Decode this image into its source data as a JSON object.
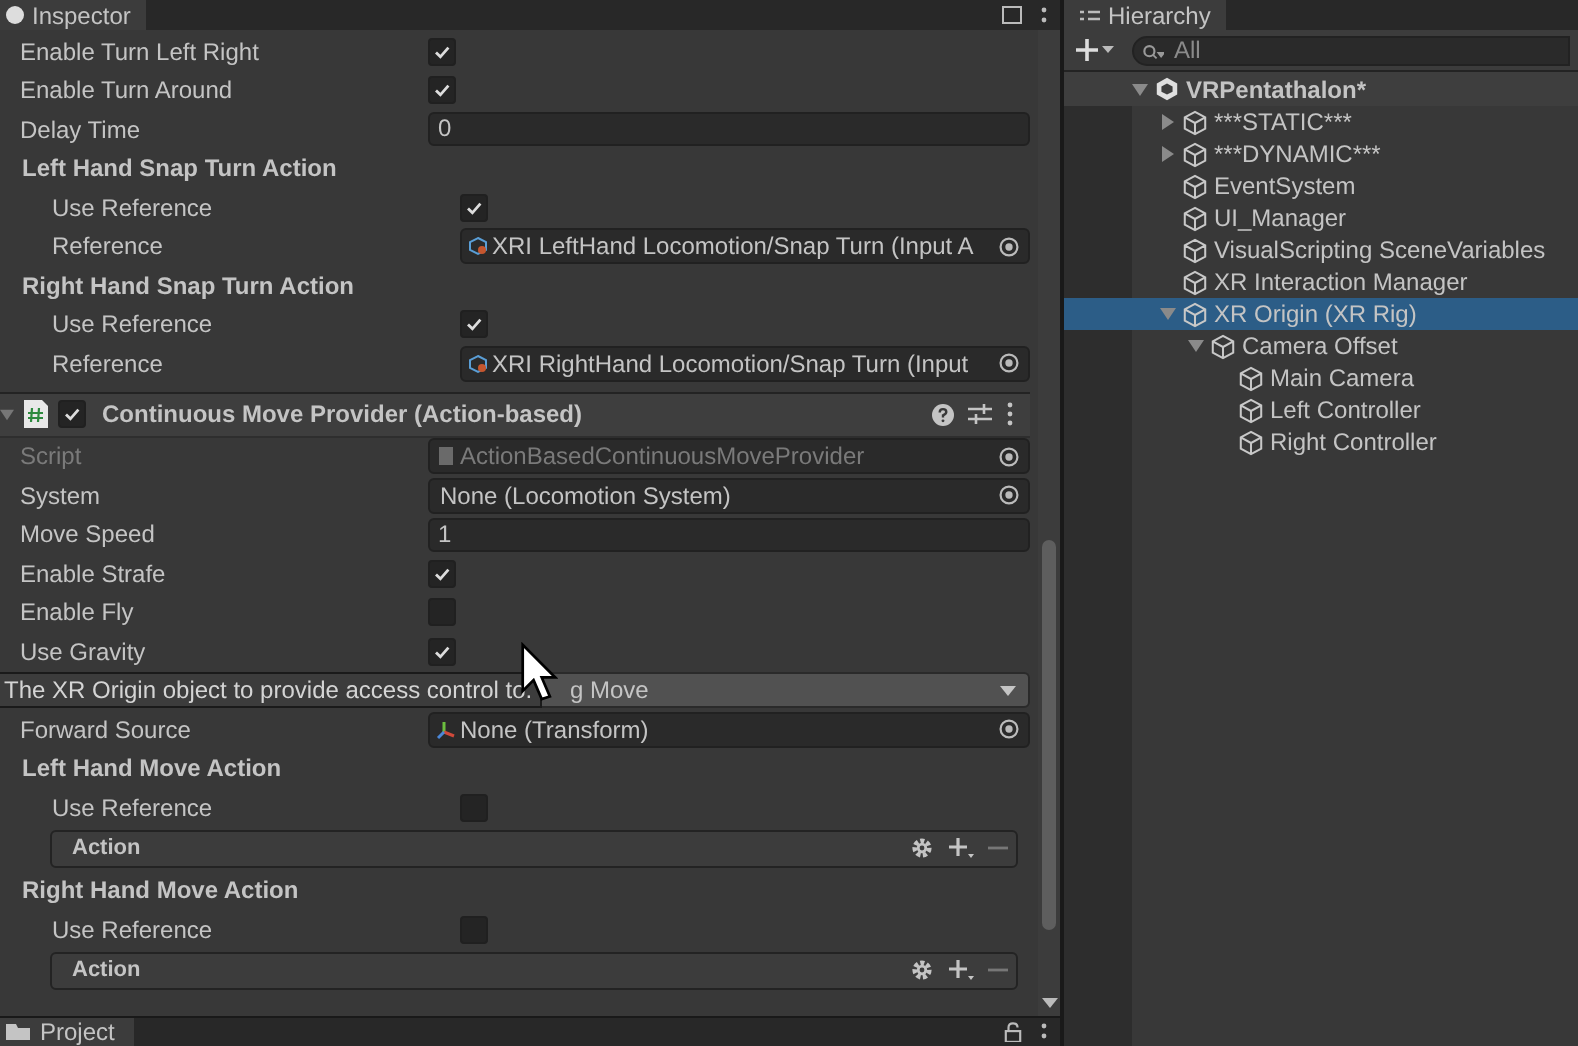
{
  "inspector": {
    "tab": "Inspector",
    "rows": [
      {
        "kind": "toggle",
        "label": "Enable Turn Left Right",
        "checked": true
      },
      {
        "kind": "toggle",
        "label": "Enable Turn Around",
        "checked": true
      },
      {
        "kind": "field",
        "label": "Delay Time",
        "value": "0"
      },
      {
        "kind": "header",
        "label": "Left Hand Snap Turn Action",
        "children": [
          {
            "kind": "toggle",
            "label": "Use Reference",
            "checked": true
          },
          {
            "kind": "reference",
            "label": "Reference",
            "value": "XRI LeftHand Locomotion/Snap Turn (Input A"
          }
        ]
      },
      {
        "kind": "header",
        "label": "Right Hand Snap Turn Action",
        "children": [
          {
            "kind": "toggle",
            "label": "Use Reference",
            "checked": true
          },
          {
            "kind": "reference",
            "label": "Reference",
            "value": "XRI RightHand Locomotion/Snap Turn (Input"
          }
        ]
      }
    ],
    "component": {
      "title": "Continuous Move Provider (Action-based)",
      "enabled": true,
      "expanded": true,
      "rows": [
        {
          "kind": "script",
          "label": "Script",
          "value": "ActionBasedContinuousMoveProvider",
          "disabled": true
        },
        {
          "kind": "object",
          "label": "System",
          "value": "None (Locomotion System)"
        },
        {
          "kind": "field",
          "label": "Move Speed",
          "value": "1"
        },
        {
          "kind": "toggle",
          "label": "Enable Strafe",
          "checked": true
        },
        {
          "kind": "toggle",
          "label": "Enable Fly",
          "checked": false
        },
        {
          "kind": "toggle",
          "label": "Use Gravity",
          "checked": true
        },
        {
          "kind": "dropdown",
          "value": "g Move"
        },
        {
          "kind": "transform",
          "label": "Forward Source",
          "value": "None (Transform)"
        },
        {
          "kind": "header",
          "label": "Left Hand Move Action",
          "children": [
            {
              "kind": "toggle",
              "label": "Use Reference",
              "checked": false
            },
            {
              "kind": "action",
              "label": "Action"
            }
          ]
        },
        {
          "kind": "header",
          "label": "Right Hand Move Action",
          "children": [
            {
              "kind": "toggle",
              "label": "Use Reference",
              "checked": false
            },
            {
              "kind": "action",
              "label": "Action"
            }
          ]
        }
      ]
    },
    "tooltip": "The XR Origin object to provide access control to."
  },
  "project": {
    "tab": "Project"
  },
  "hierarchy": {
    "tab": "Hierarchy",
    "search": {
      "placeholder": "All"
    },
    "items": [
      {
        "label": "VRPentathalon*",
        "kind": "scene",
        "expanded": true,
        "selected": false,
        "children": [
          {
            "label": "***STATIC***",
            "kind": "object",
            "expanded": false,
            "selected": false
          },
          {
            "label": "***DYNAMIC***",
            "kind": "object",
            "expanded": false,
            "selected": false
          },
          {
            "label": "EventSystem",
            "kind": "object",
            "selected": false
          },
          {
            "label": "UI_Manager",
            "kind": "object",
            "selected": false
          },
          {
            "label": "VisualScripting SceneVariables",
            "kind": "object",
            "selected": false
          },
          {
            "label": "XR Interaction Manager",
            "kind": "object",
            "selected": false
          },
          {
            "label": "XR Origin (XR Rig)",
            "kind": "object",
            "expanded": true,
            "selected": true,
            "children": [
              {
                "label": "Camera Offset",
                "kind": "object",
                "expanded": true,
                "selected": false,
                "children": [
                  {
                    "label": "Main Camera",
                    "kind": "object",
                    "selected": false
                  },
                  {
                    "label": "Left Controller",
                    "kind": "object",
                    "selected": false
                  },
                  {
                    "label": "Right Controller",
                    "kind": "object",
                    "selected": false
                  }
                ]
              }
            ]
          }
        ]
      }
    ]
  }
}
